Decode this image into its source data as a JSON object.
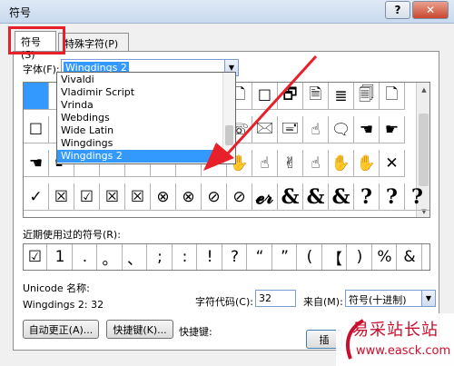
{
  "window": {
    "title": "符号",
    "help_label": "?",
    "close_label": "✕"
  },
  "tabs": [
    {
      "label": "符号(S)"
    },
    {
      "label": "特殊字符(P)"
    }
  ],
  "font": {
    "label": "字体(F):",
    "value": "Wingdings 2",
    "options": [
      "Vivaldi",
      "Vladimir Script",
      "Vrinda",
      "Webdings",
      "Wide Latin",
      "Wingdings",
      "Wingdings 2"
    ],
    "selected_index": 6
  },
  "symbol_grid": [
    [
      " ",
      " ",
      " ",
      " ",
      " ",
      " ",
      " ",
      " ",
      "🗋",
      "☐",
      "🗗",
      "🗎",
      "≣",
      "🗐",
      "🗋"
    ],
    [
      "☐",
      " ",
      " ",
      " ",
      " ",
      " ",
      " ",
      " ",
      "☏",
      "🖂",
      "🖃",
      "☝",
      "🗨",
      "☚",
      "☛"
    ],
    [
      "☚",
      "☛",
      " ",
      " ",
      " ",
      " ",
      " ",
      " ",
      "✋",
      "☝",
      "✌",
      "☝",
      "✋",
      "✋",
      "✕"
    ],
    [
      "✓",
      "☒",
      "☑",
      "☒",
      "☒",
      "⊗",
      "⊗",
      "⊘",
      "⊘",
      "𝓮𝓇",
      "&",
      "&",
      "&",
      "?",
      "?",
      "?"
    ]
  ],
  "recent": {
    "label": "近期使用过的符号(R):",
    "symbols": [
      "☑",
      "1",
      ".",
      "。",
      "、",
      ";",
      ":",
      "!",
      "?",
      "“",
      "”",
      "(",
      "【",
      ")",
      "%",
      "&"
    ]
  },
  "unicode": {
    "name_label": "Unicode 名称:",
    "name_value": "Wingdings 2: 32"
  },
  "char_code": {
    "label": "字符代码(C):",
    "value": "32"
  },
  "from": {
    "label": "来自(M):",
    "value": "符号(十进制)"
  },
  "buttons": {
    "autocorrect": "自动更正(A)...",
    "shortcut_key": "快捷键(K)...",
    "shortcut_label": "快捷键:",
    "insert": "插"
  },
  "watermark": {
    "title": "易采站长站",
    "url": "www.easck.com"
  },
  "colors": {
    "selection": "#3399ff",
    "highlight_box": "#e8202a",
    "arrow": "#e8202a",
    "watermark": "#c8102e"
  }
}
